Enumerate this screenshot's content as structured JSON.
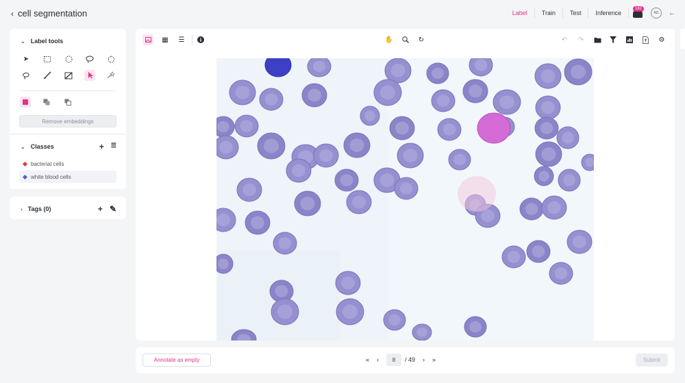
{
  "project": {
    "back_icon": "chevron-left-icon",
    "title": "cell segmentation"
  },
  "nav": {
    "tabs": [
      {
        "label": "Label",
        "active": true
      },
      {
        "label": "Train",
        "active": false
      },
      {
        "label": "Test",
        "active": false
      },
      {
        "label": "Inference",
        "active": false
      }
    ],
    "notification_count": "182",
    "avatar_initials": "AD"
  },
  "label_tools": {
    "title": "Label tools",
    "tools": [
      "pointer-icon",
      "rectangle-icon",
      "ellipse-icon",
      "lasso-icon",
      "polygon-icon",
      "freehand-lasso-icon",
      "brush-icon",
      "eraser-icon",
      "smart-select-icon",
      "magic-wand-icon"
    ],
    "selected_tool": 8,
    "remove_embeddings_label": "Remove embeddings"
  },
  "classes": {
    "title": "Classes",
    "items": [
      {
        "label": "bacterial cells",
        "color": "#e53935"
      },
      {
        "label": "white blood cells",
        "color": "#5b5fc7"
      }
    ],
    "selected": 1
  },
  "tags": {
    "title": "Tags (0)"
  },
  "pagination": {
    "current": "8",
    "total": "/ 49"
  },
  "bottom": {
    "annotate_empty_label": "Annotate as empty",
    "submit_label": "Submit"
  },
  "colors": {
    "accent": "#e0338a",
    "cell": "#8e86c9",
    "canvas_bg": "#edf3f8"
  }
}
